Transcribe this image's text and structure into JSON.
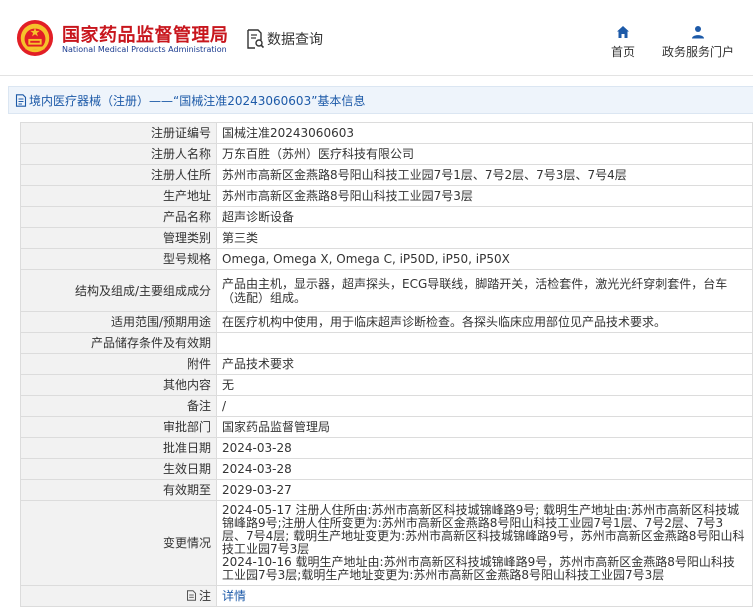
{
  "header": {
    "org_name_cn": "国家药品监督管理局",
    "org_name_en": "National Medical Products Administration",
    "page_title": "数据查询",
    "nav": [
      {
        "label": "首页",
        "icon": "home-icon"
      },
      {
        "label": "政务服务门户",
        "icon": "user-icon"
      }
    ]
  },
  "colors": {
    "brand_red": "#c8161d",
    "link_blue": "#1d5aa8"
  },
  "section_title": "境内医疗器械（注册）——“国械注准20243060603”基本信息",
  "records": [
    {
      "label": "注册证编号",
      "value": "国械注准20243060603"
    },
    {
      "label": "注册人名称",
      "value": "万东百胜（苏州）医疗科技有限公司"
    },
    {
      "label": "注册人住所",
      "value": "苏州市高新区金燕路8号阳山科技工业园7号1层、7号2层、7号3层、7号4层"
    },
    {
      "label": "生产地址",
      "value": "苏州市高新区金燕路8号阳山科技工业园7号3层"
    },
    {
      "label": "产品名称",
      "value": "超声诊断设备"
    },
    {
      "label": "管理类别",
      "value": "第三类"
    },
    {
      "label": "型号规格",
      "value": "Omega, Omega X, Omega C, iP50D, iP50, iP50X"
    },
    {
      "label": "结构及组成/主要组成成分",
      "value": "产品由主机，显示器，超声探头，ECG导联线，脚踏开关，活检套件，激光光纤穿刺套件，台车（选配）组成。"
    },
    {
      "label": "适用范围/预期用途",
      "value": "在医疗机构中使用，用于临床超声诊断检查。各探头临床应用部位见产品技术要求。"
    },
    {
      "label": "产品储存条件及有效期",
      "value": ""
    },
    {
      "label": "附件",
      "value": "产品技术要求"
    },
    {
      "label": "其他内容",
      "value": "无"
    },
    {
      "label": "备注",
      "value": "/"
    },
    {
      "label": "审批部门",
      "value": "国家药品监督管理局"
    },
    {
      "label": "批准日期",
      "value": "2024-03-28"
    },
    {
      "label": "生效日期",
      "value": "2024-03-28"
    },
    {
      "label": "有效期至",
      "value": "2029-03-27"
    },
    {
      "label": "变更情况",
      "value": "2024-05-17 注册人住所由:苏州市高新区科技城锦峰路9号; 载明生产地址由:苏州市高新区科技城锦峰路9号;注册人住所变更为:苏州市高新区金燕路8号阳山科技工业园7号1层、7号2层、7号3层、7号4层; 载明生产地址变更为:苏州市高新区科技城锦峰路9号，苏州市高新区金燕路8号阳山科技工业园7号3层\n2024-10-16 载明生产地址由:苏州市高新区科技城锦峰路9号，苏州市高新区金燕路8号阳山科技工业园7号3层;载明生产地址变更为:苏州市高新区金燕路8号阳山科技工业园7号3层"
    },
    {
      "label": "注",
      "value": "详情",
      "icon": "note-icon"
    }
  ]
}
